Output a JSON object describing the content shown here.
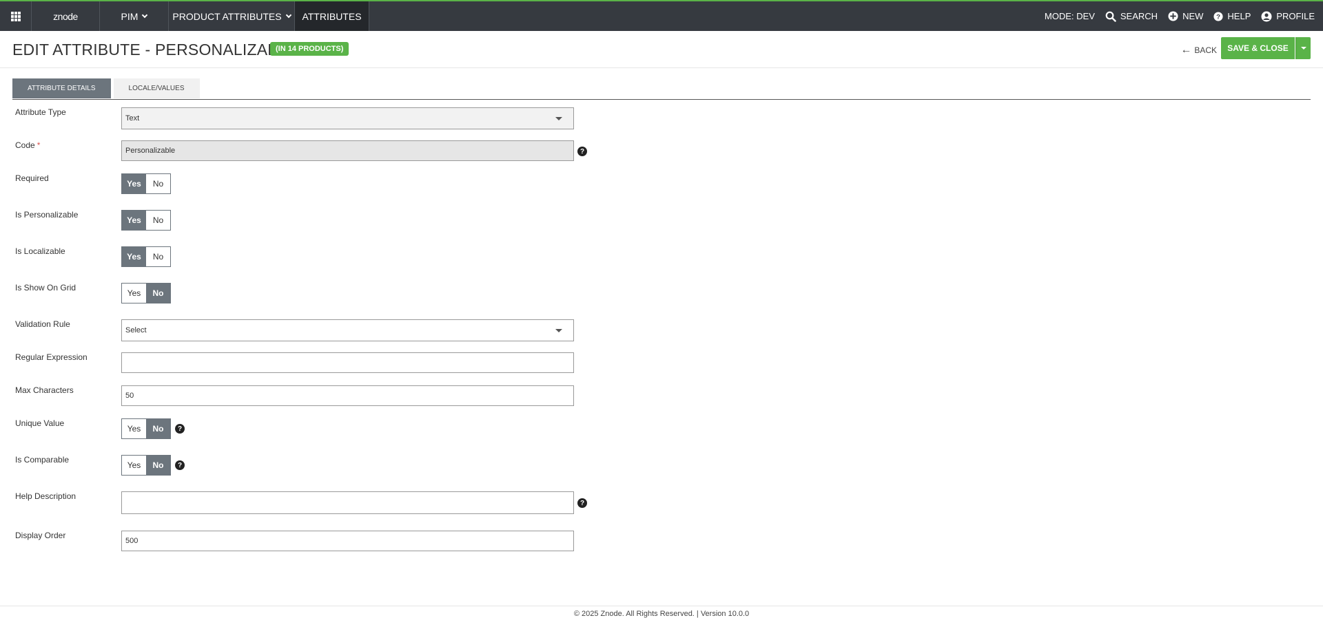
{
  "nav": {
    "logo": "znode",
    "pim": "PIM",
    "product_attributes": "PRODUCT ATTRIBUTES",
    "attributes": "ATTRIBUTES",
    "mode": "MODE: DEV",
    "search": "SEARCH",
    "new": "NEW",
    "help": "HELP",
    "profile": "PROFILE"
  },
  "header": {
    "title": "EDIT ATTRIBUTE - PERSONALIZABLE",
    "badge": "(IN 14 PRODUCTS)",
    "back": "BACK",
    "save_close": "SAVE & CLOSE"
  },
  "tabs": [
    {
      "label": "ATTRIBUTE DETAILS",
      "active": true
    },
    {
      "label": "LOCALE/VALUES",
      "active": false
    }
  ],
  "form": {
    "attribute_type": {
      "label": "Attribute Type",
      "value": "Text"
    },
    "code": {
      "label": "Code",
      "required_mark": "*",
      "value": "Personalizable"
    },
    "required": {
      "label": "Required",
      "yes": "Yes",
      "no": "No",
      "selected": "Yes"
    },
    "is_personalizable": {
      "label": "Is Personalizable",
      "yes": "Yes",
      "no": "No",
      "selected": "Yes"
    },
    "is_localizable": {
      "label": "Is Localizable",
      "yes": "Yes",
      "no": "No",
      "selected": "Yes"
    },
    "is_show_on_grid": {
      "label": "Is Show On Grid",
      "yes": "Yes",
      "no": "No",
      "selected": "No"
    },
    "validation_rule": {
      "label": "Validation Rule",
      "value": "Select"
    },
    "regular_expression": {
      "label": "Regular Expression",
      "value": ""
    },
    "max_characters": {
      "label": "Max Characters",
      "value": "50"
    },
    "unique_value": {
      "label": "Unique Value",
      "yes": "Yes",
      "no": "No",
      "selected": "No"
    },
    "is_comparable": {
      "label": "Is Comparable",
      "yes": "Yes",
      "no": "No",
      "selected": "No"
    },
    "help_description": {
      "label": "Help Description",
      "value": ""
    },
    "display_order": {
      "label": "Display Order",
      "value": "500"
    }
  },
  "footer": {
    "text": "© 2025 Znode. All Rights Reserved. | Version 10.0.0"
  },
  "colors": {
    "topbar": "#363a40",
    "accent_green": "#5ab348",
    "toggle_on": "#6c757d"
  }
}
